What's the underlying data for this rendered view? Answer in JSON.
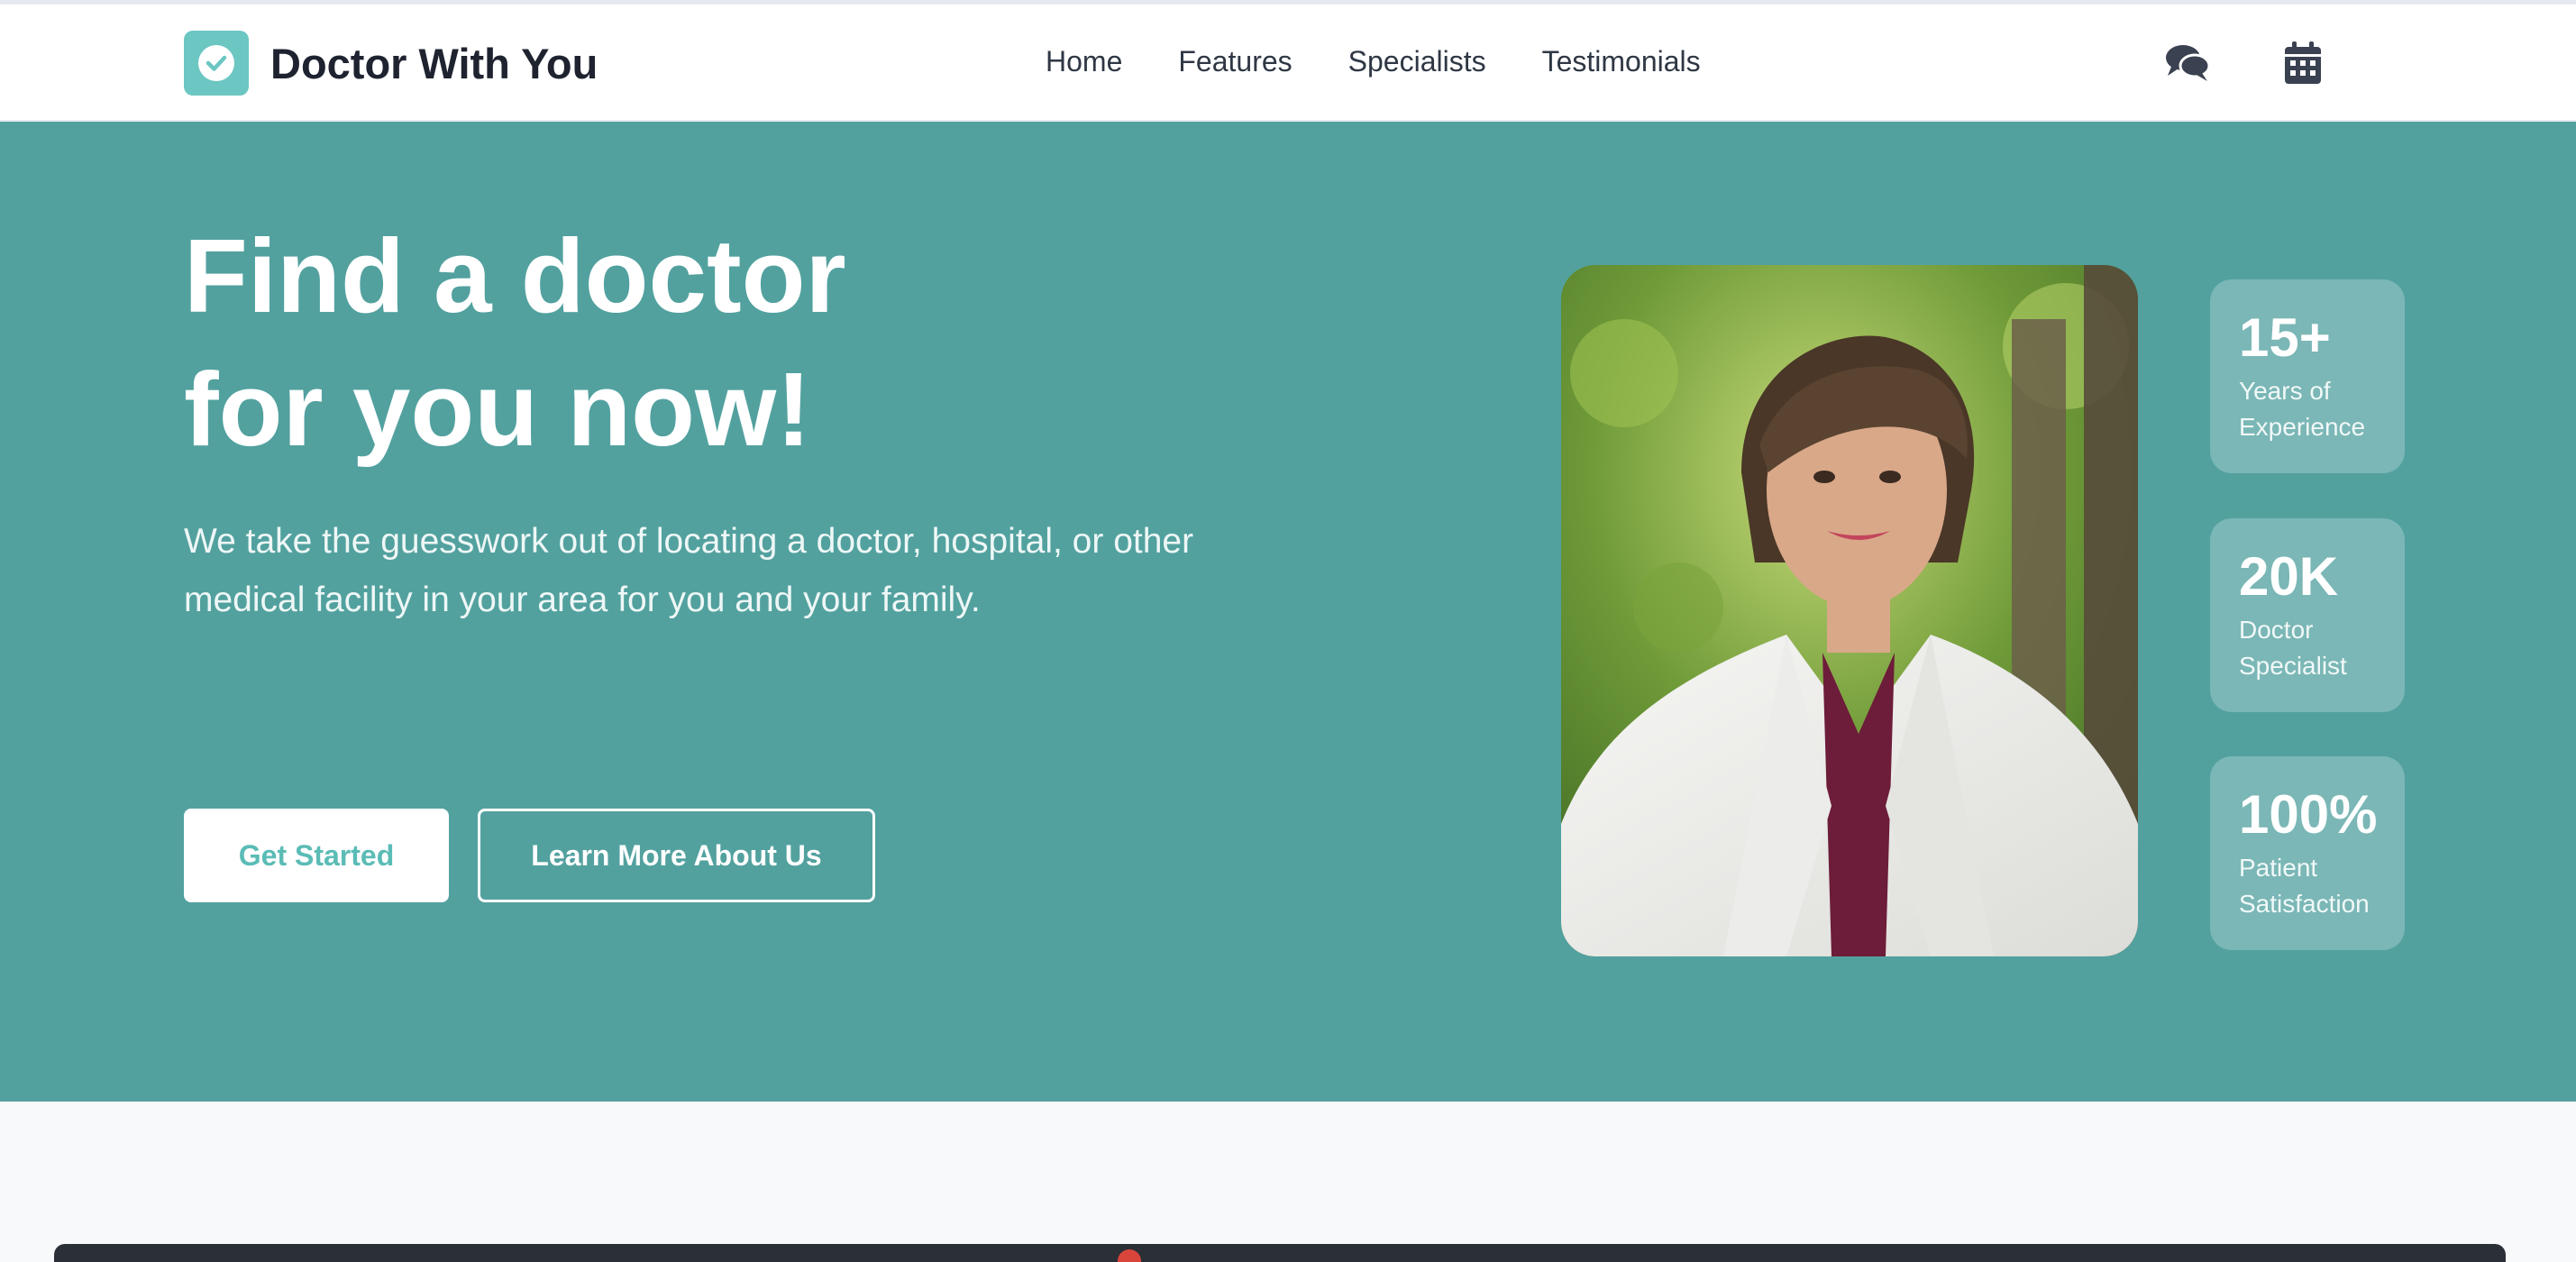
{
  "header": {
    "brand": "Doctor With You",
    "logo_icon": "check-circle-icon",
    "nav": [
      "Home",
      "Features",
      "Specialists",
      "Testimonials"
    ],
    "icons": [
      "chat-icon",
      "calendar-icon"
    ]
  },
  "hero": {
    "title_line1": "Find a doctor",
    "title_line2": "for you now!",
    "subtitle_line1": "We take the guesswork out of locating a doctor, hospital, or other",
    "subtitle_line2": "medical facility in your area for you and your family.",
    "primary_button": "Get Started",
    "secondary_button": "Learn More About Us",
    "photo_icon": "doctor-portrait-image"
  },
  "stats": [
    {
      "value": "15+",
      "label": "Years of Experience"
    },
    {
      "value": "20K",
      "label": "Doctor Specialist"
    },
    {
      "value": "100%",
      "label": "Patient Satisfaction"
    }
  ],
  "colors": {
    "accent": "#52a19f",
    "logo": "#6cc6c2",
    "button_text": "#5bbcb6",
    "stat_card": "#7ab7b6"
  }
}
